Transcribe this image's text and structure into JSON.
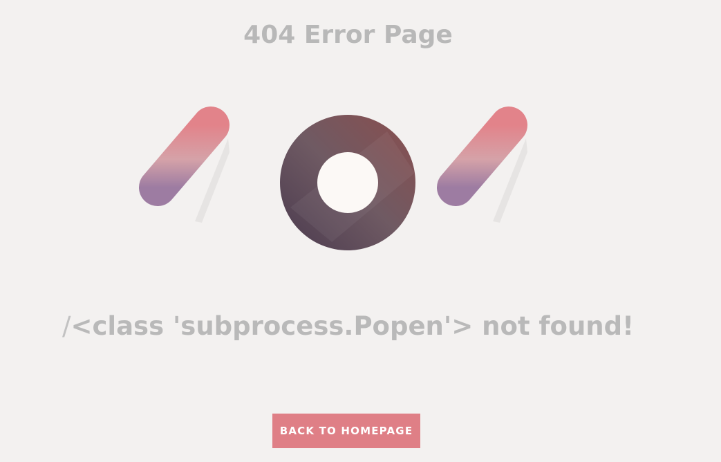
{
  "page_title": "404 Error Page",
  "hero": {
    "digits": [
      "4",
      "0",
      "4"
    ],
    "colors": {
      "pink": "#e38183",
      "mauve": "#d9a0a5",
      "purple": "#9c7aa0",
      "dark_ring": "#5a4656",
      "ring_light": "#8a5a5a",
      "hole": "#fcf9f6"
    }
  },
  "message": {
    "prefix": "/",
    "text": "<class 'subprocess.Popen'> not found!"
  },
  "back_button": {
    "label": "BACK TO HOMEPAGE",
    "color": "#df7f86"
  },
  "background": "#f3f1f0"
}
